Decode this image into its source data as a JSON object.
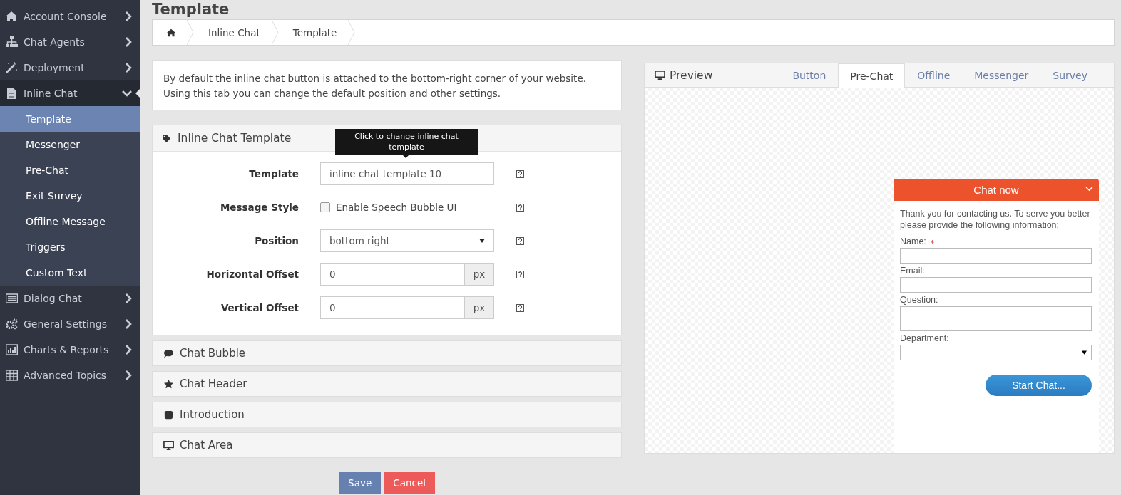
{
  "sidebar": {
    "items": [
      {
        "label": "Account Console",
        "expanded": false
      },
      {
        "label": "Chat Agents",
        "expanded": false
      },
      {
        "label": "Deployment",
        "expanded": false
      },
      {
        "label": "Inline Chat",
        "expanded": true,
        "children": [
          {
            "label": "Template",
            "selected": true
          },
          {
            "label": "Messenger",
            "selected": false
          },
          {
            "label": "Pre-Chat",
            "selected": false
          },
          {
            "label": "Exit Survey",
            "selected": false
          },
          {
            "label": "Offline Message",
            "selected": false
          },
          {
            "label": "Triggers",
            "selected": false
          },
          {
            "label": "Custom Text",
            "selected": false
          }
        ]
      },
      {
        "label": "Dialog Chat",
        "expanded": false
      },
      {
        "label": "General Settings",
        "expanded": false
      },
      {
        "label": "Charts & Reports",
        "expanded": false
      },
      {
        "label": "Advanced Topics",
        "expanded": false
      }
    ]
  },
  "page_title": "Template",
  "breadcrumb": [
    "Inline Chat",
    "Template"
  ],
  "description": "By default the inline chat button is attached to the bottom-right corner of your website. Using this tab you can change the default position and other settings.",
  "template_panel": {
    "title": "Inline Chat Template",
    "tooltip": "Click to change inline chat template",
    "fields": [
      {
        "kind": "text",
        "label": "Template",
        "value": "inline chat template 10"
      },
      {
        "kind": "checkbox",
        "label": "Message Style",
        "option": "Enable Speech Bubble UI",
        "checked": false
      },
      {
        "kind": "select",
        "label": "Position",
        "value": "bottom right"
      },
      {
        "kind": "unit",
        "label": "Horizontal Offset",
        "value": "0",
        "unit": "px"
      },
      {
        "kind": "unit",
        "label": "Vertical Offset",
        "value": "0",
        "unit": "px"
      }
    ]
  },
  "sections": [
    "Chat Bubble",
    "Chat Header",
    "Introduction",
    "Chat Area"
  ],
  "buttons": [
    {
      "label": "Save",
      "kind": "primary"
    },
    {
      "label": "Cancel",
      "kind": "danger"
    }
  ],
  "preview": {
    "title": "Preview",
    "tabs": [
      {
        "label": "Button",
        "selected": false
      },
      {
        "label": "Pre-Chat",
        "selected": true
      },
      {
        "label": "Offline",
        "selected": false
      },
      {
        "label": "Messenger",
        "selected": false
      },
      {
        "label": "Survey",
        "selected": false
      }
    ],
    "widget": {
      "title": "Chat now",
      "intro": "Thank you for contacting us. To serve you better please provide the following information:",
      "fields": [
        {
          "kind": "text",
          "label": "Name:",
          "required": true
        },
        {
          "kind": "text",
          "label": "Email:",
          "required": false
        },
        {
          "kind": "textarea",
          "label": "Question:",
          "required": false
        },
        {
          "kind": "select",
          "label": "Department:",
          "required": false
        }
      ],
      "button": "Start Chat..."
    }
  }
}
